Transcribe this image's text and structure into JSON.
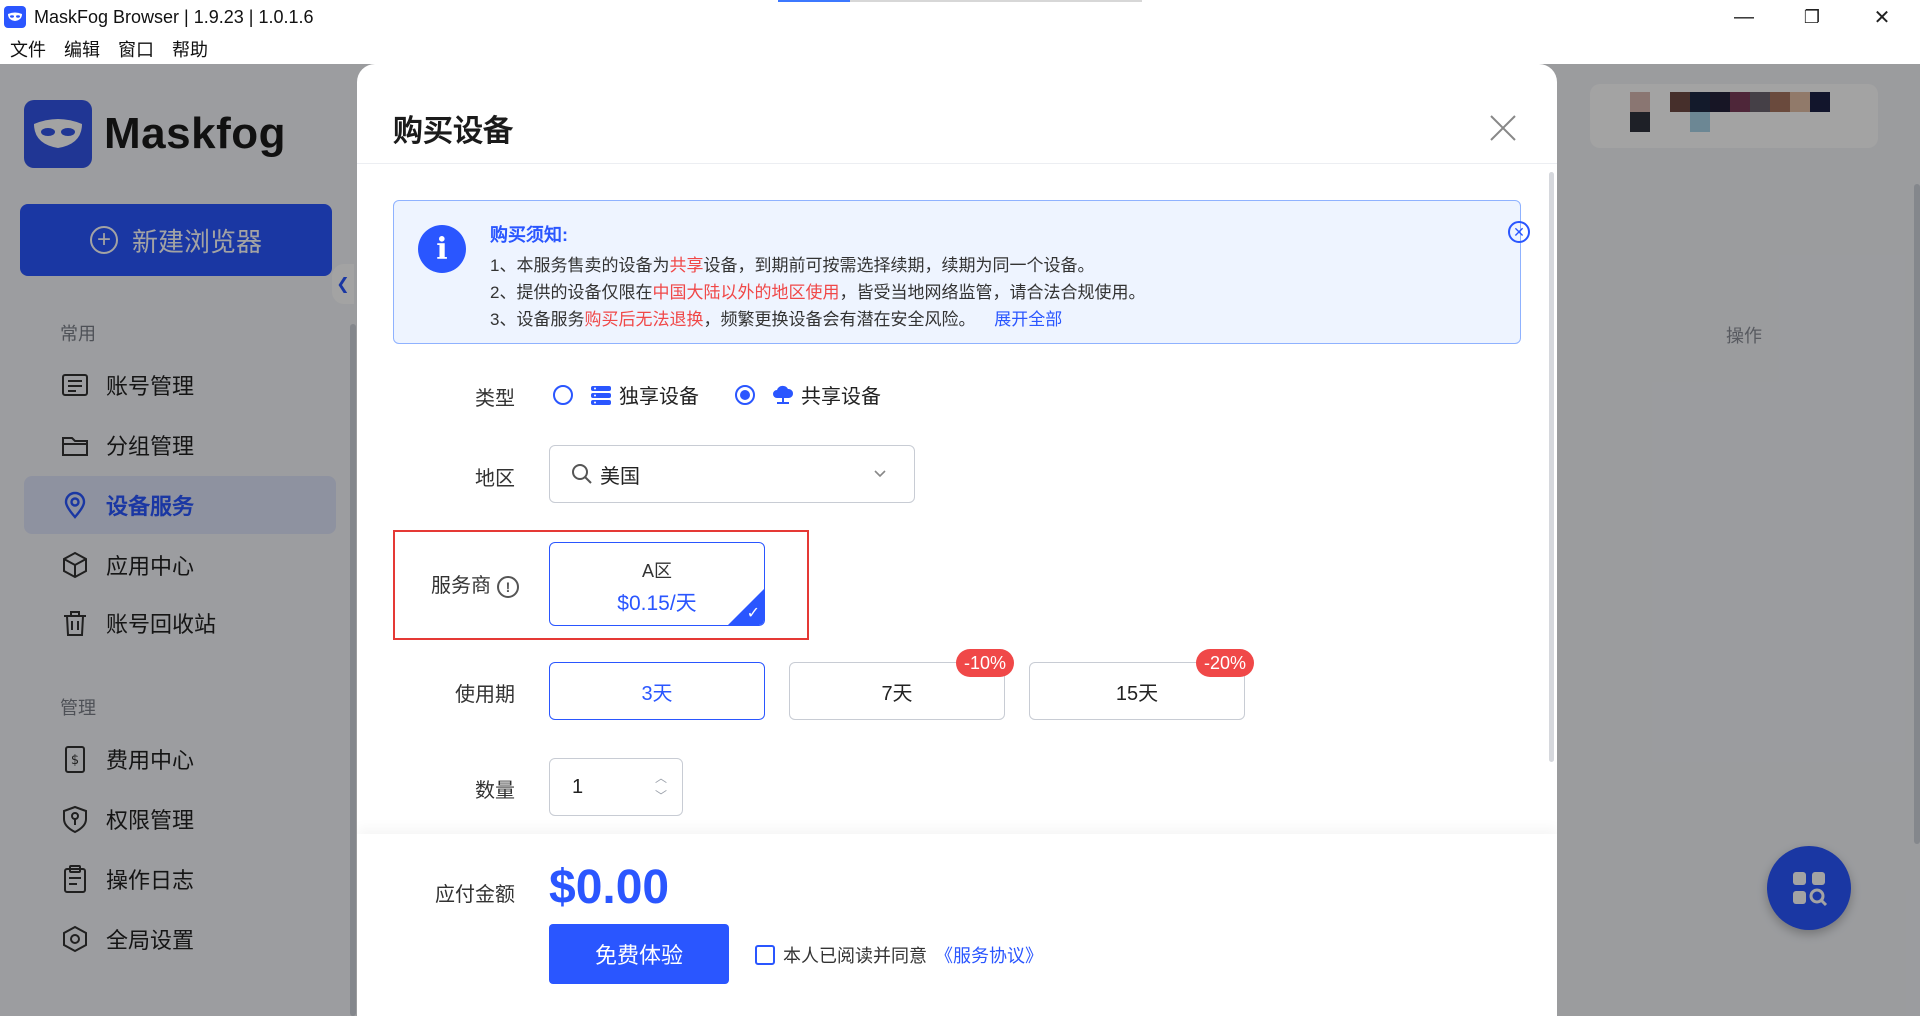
{
  "window": {
    "title": "MaskFog Browser | 1.9.23 | 1.0.1.6",
    "minimize": "—",
    "maximize": "❐",
    "close": "✕"
  },
  "menu": [
    "文件",
    "编辑",
    "窗口",
    "帮助"
  ],
  "sidebar": {
    "logo_text": "Maskfog",
    "new_button": "新建浏览器",
    "section_common": "常用",
    "section_manage": "管理",
    "items_common": [
      {
        "label": "账号管理",
        "icon": "id-card-icon"
      },
      {
        "label": "分组管理",
        "icon": "folder-icon"
      },
      {
        "label": "设备服务",
        "icon": "location-pin-icon",
        "active": true
      },
      {
        "label": "应用中心",
        "icon": "cube-icon"
      },
      {
        "label": "账号回收站",
        "icon": "trash-icon"
      }
    ],
    "items_manage": [
      {
        "label": "费用中心",
        "icon": "receipt-icon"
      },
      {
        "label": "权限管理",
        "icon": "shield-key-icon"
      },
      {
        "label": "操作日志",
        "icon": "clipboard-icon"
      },
      {
        "label": "全局设置",
        "icon": "settings-hexagon-icon"
      }
    ]
  },
  "content": {
    "col_action": "操作"
  },
  "modal": {
    "title": "购买设备",
    "notice": {
      "title": "购买须知:",
      "line1_a": "1、本服务售卖的设备为",
      "line1_red": "共享",
      "line1_b": "设备，到期前可按需选择续期，续期为同一个设备。",
      "line2_a": "2、提供的设备仅限在",
      "line2_red": "中国大陆以外的地区使用",
      "line2_b": "，皆受当地网络监管，请合法合规使用。",
      "line3_a": "3、设备服务",
      "line3_red": "购买后无法退换",
      "line3_b": "，频繁更换设备会有潜在安全风险。",
      "expand": "展开全部"
    },
    "type_label": "类型",
    "type_options": [
      {
        "label": "独享设备",
        "selected": false
      },
      {
        "label": "共享设备",
        "selected": true
      }
    ],
    "region_label": "地区",
    "region_value": "美国",
    "vendor_label": "服务商",
    "vendor": {
      "name": "A区",
      "price": "$0.15/天",
      "selected": true
    },
    "period_label": "使用期",
    "periods": [
      {
        "label": "3天",
        "badge": "",
        "active": true
      },
      {
        "label": "7天",
        "badge": "-10%",
        "active": false
      },
      {
        "label": "15天",
        "badge": "-20%",
        "active": false
      }
    ],
    "quantity_label": "数量",
    "quantity_value": "1",
    "amount_label": "应付金额",
    "amount_value": "$0.00",
    "submit": "免费体验",
    "agree_text": "本人已阅读并同意",
    "agree_link": "《服务协议》"
  },
  "colors": {
    "accent": "#2a56ff",
    "danger": "#f04848",
    "notice_bg": "#eef4ff"
  }
}
